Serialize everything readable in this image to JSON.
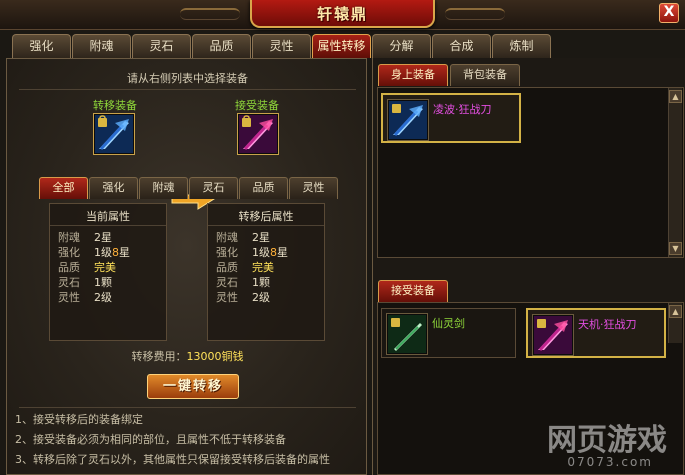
{
  "window": {
    "title": "轩辕鼎",
    "close_label": "X"
  },
  "tabs": [
    {
      "label": "强化",
      "active": false
    },
    {
      "label": "附魂",
      "active": false
    },
    {
      "label": "灵石",
      "active": false
    },
    {
      "label": "品质",
      "active": false
    },
    {
      "label": "灵性",
      "active": false
    },
    {
      "label": "属性转移",
      "active": true
    },
    {
      "label": "分解",
      "active": false
    },
    {
      "label": "合成",
      "active": false
    },
    {
      "label": "炼制",
      "active": false
    }
  ],
  "transfer": {
    "instruction": "请从右侧列表中选择装备",
    "source_label": "转移装备",
    "target_label": "接受装备",
    "filters": [
      {
        "label": "全部",
        "active": true
      },
      {
        "label": "强化",
        "active": false
      },
      {
        "label": "附魂",
        "active": false
      },
      {
        "label": "灵石",
        "active": false
      },
      {
        "label": "品质",
        "active": false
      },
      {
        "label": "灵性",
        "active": false
      }
    ],
    "current": {
      "title": "当前属性",
      "rows": [
        {
          "key": "附魂",
          "value": "2星"
        },
        {
          "key": "强化",
          "value_a": "1级",
          "value_b": "8",
          "value_c": "星"
        },
        {
          "key": "品质",
          "value": "完美"
        },
        {
          "key": "灵石",
          "value": "1颗"
        },
        {
          "key": "灵性",
          "value": "2级"
        }
      ]
    },
    "after": {
      "title": "转移后属性",
      "rows": [
        {
          "key": "附魂",
          "value": "2星"
        },
        {
          "key": "强化",
          "value_a": "1级",
          "value_b": "8",
          "value_c": "星"
        },
        {
          "key": "品质",
          "value": "完美"
        },
        {
          "key": "灵石",
          "value": "1颗"
        },
        {
          "key": "灵性",
          "value": "2级"
        }
      ]
    },
    "cost_label": "转移费用：",
    "cost_value": "13000铜钱",
    "action_label": "一键转移",
    "notes": [
      "1、接受转移后的装备绑定",
      "2、接受装备必须为相同的部位，且属性不低于转移装备",
      "3、转移后除了灵石以外，其他属性只保留接受转移后装备的属性"
    ]
  },
  "inventory": {
    "tabs": [
      {
        "label": "身上装备",
        "active": true
      },
      {
        "label": "背包装备",
        "active": false
      }
    ],
    "items": [
      {
        "name": "凌波·狂战刀",
        "color": "#e24ee0"
      }
    ],
    "receive_tab": "接受装备",
    "receive_items": [
      {
        "name": "仙灵剑",
        "color": "#8fd83a"
      },
      {
        "name": "天机·狂战刀",
        "color": "#e24ee0"
      }
    ],
    "scroll_up": "▲",
    "scroll_down": "▼"
  },
  "watermark": {
    "text": "网页游戏",
    "sub": "07073.com"
  },
  "colors": {
    "accent_red": "#a72116",
    "gold": "#d3b246",
    "green": "#8fd83a",
    "purple": "#e24ee0",
    "yellow": "#ffe25a"
  }
}
